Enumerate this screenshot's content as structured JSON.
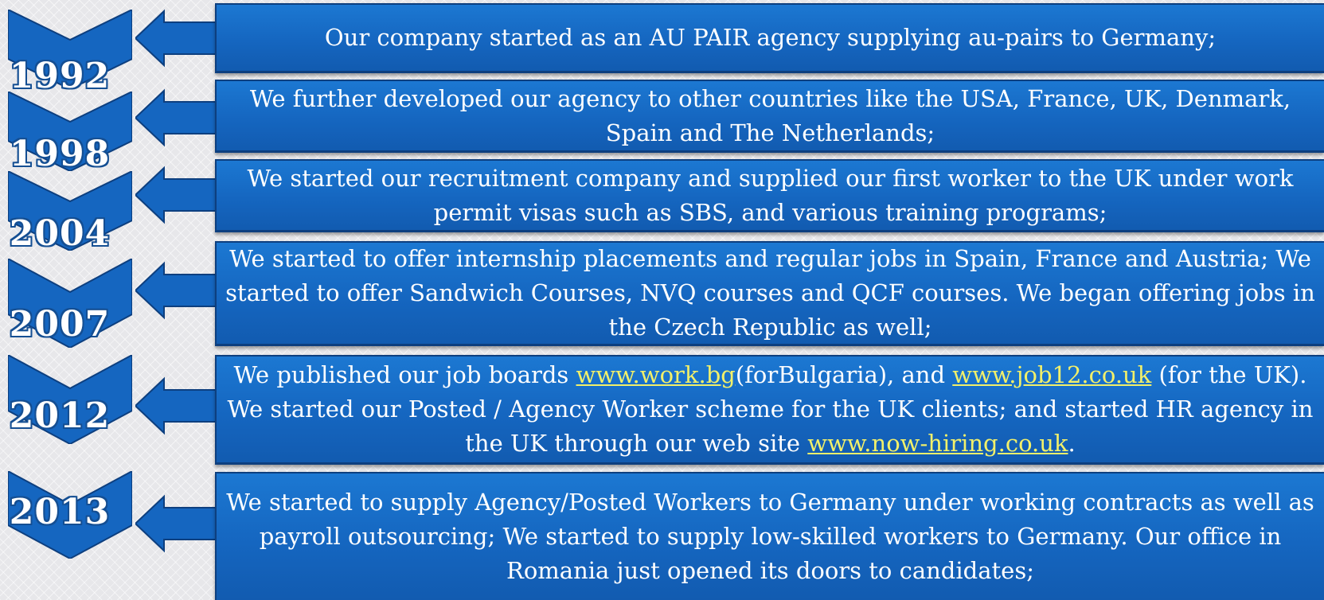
{
  "timeline": [
    {
      "year": "1992",
      "text": "Our company started as an AU PAIR agency supplying au-pairs to  Germany;"
    },
    {
      "year": "1998",
      "text": "We further developed our agency to other countries like the USA, France, UK, Denmark, Spain and The Netherlands;"
    },
    {
      "year": "2004",
      "text": "We started our recruitment company and supplied our first worker to the UK under work permit visas such as SBS, and various training programs;"
    },
    {
      "year": "2007",
      "text": "We started to offer internship placements and regular jobs in Spain, France and Austria; We started to offer Sandwich Courses, NVQ courses and QCF courses. We began offering jobs in the Czech Republic as well;"
    },
    {
      "year": "2012",
      "text_parts": {
        "p1": "We published our job boards ",
        "link1": "www.work.bg",
        "p2": "(forBulgaria), and ",
        "link2": "www.job12.co.uk",
        "p3": " (for the UK). We started our Posted / Agency Worker scheme for the UK clients; and started HR agency in the UK through our web site ",
        "link3": "www.now-hiring.co.uk",
        "p4": "."
      }
    },
    {
      "year": "2013",
      "text": "We started to supply Agency/Posted Workers to Germany under working contracts as well as payroll outsourcing; We started to supply low-skilled workers to Germany. Our office in Romania just opened its doors to candidates;"
    }
  ],
  "colors": {
    "box": "#1566c0",
    "box_border": "#0d3f7f",
    "link": "#f2f06a",
    "year_outline": "#154f93"
  }
}
